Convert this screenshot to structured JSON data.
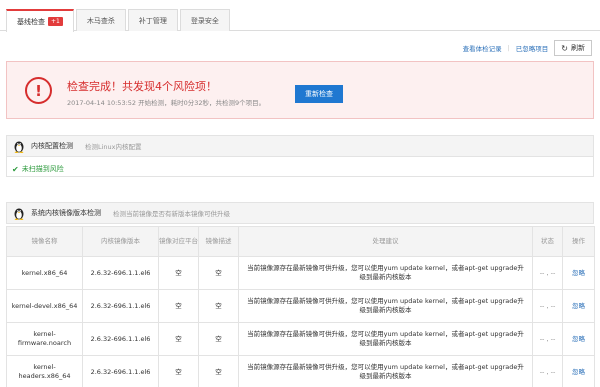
{
  "tabs": [
    {
      "label": "基线检查",
      "badge": "+1",
      "active": true
    },
    {
      "label": "木马查杀"
    },
    {
      "label": "补丁管理"
    },
    {
      "label": "登录安全"
    }
  ],
  "toolbar": {
    "history": "查看体检记录",
    "ignored": "已忽略项目",
    "separator": "|",
    "refresh": "刷新"
  },
  "alert": {
    "title": "检查完成！共发现4个风险项！",
    "subtitle": "2017-04-14 10:53:52 开始检测，耗时0分32秒，共检测9个项目。",
    "recheck": "重新检查",
    "icon_glyph": "!"
  },
  "kernel_config": {
    "title": "内核配置检测",
    "desc": "检测Linux内核配置",
    "result": "未扫描到风险"
  },
  "kernel_image": {
    "title": "系统内核镜像版本检测",
    "desc": "检测当前镜像是否有新版本镜像可供升级"
  },
  "table": {
    "headers": [
      "镜像名称",
      "内核镜像版本",
      "镜像对应平台",
      "镜像描述",
      "处理建议",
      "状态",
      "操作"
    ],
    "rows": [
      {
        "name": "kernel.x86_64",
        "version": "2.6.32-696.1.1.el6",
        "platform": "空",
        "desc": "空",
        "advice": "当前镜像源存在最新镜像可供升级，您可以使用yum update kernel，或者apt-get upgrade升级到最新内核版本",
        "status": "-- , --",
        "action": "忽略"
      },
      {
        "name": "kernel-devel.x86_64",
        "version": "2.6.32-696.1.1.el6",
        "platform": "空",
        "desc": "空",
        "advice": "当前镜像源存在最新镜像可供升级，您可以使用yum update kernel，或者apt-get upgrade升级到最新内核版本",
        "status": "-- , --",
        "action": "忽略"
      },
      {
        "name": "kernel-firmware.noarch",
        "version": "2.6.32-696.1.1.el6",
        "platform": "空",
        "desc": "空",
        "advice": "当前镜像源存在最新镜像可供升级，您可以使用yum update kernel，或者apt-get upgrade升级到最新内核版本",
        "status": "-- , --",
        "action": "忽略"
      },
      {
        "name": "kernel-headers.x86_64",
        "version": "2.6.32-696.1.1.el6",
        "platform": "空",
        "desc": "空",
        "advice": "当前镜像源存在最新镜像可供升级，您可以使用yum update kernel，或者apt-get upgrade升级到最新内核版本",
        "status": "-- , --",
        "action": "忽略"
      }
    ]
  },
  "colors": {
    "danger": "#d62d2d",
    "primary": "#1f78d1",
    "link": "#2a6fb8",
    "success": "#2e9b3e"
  }
}
